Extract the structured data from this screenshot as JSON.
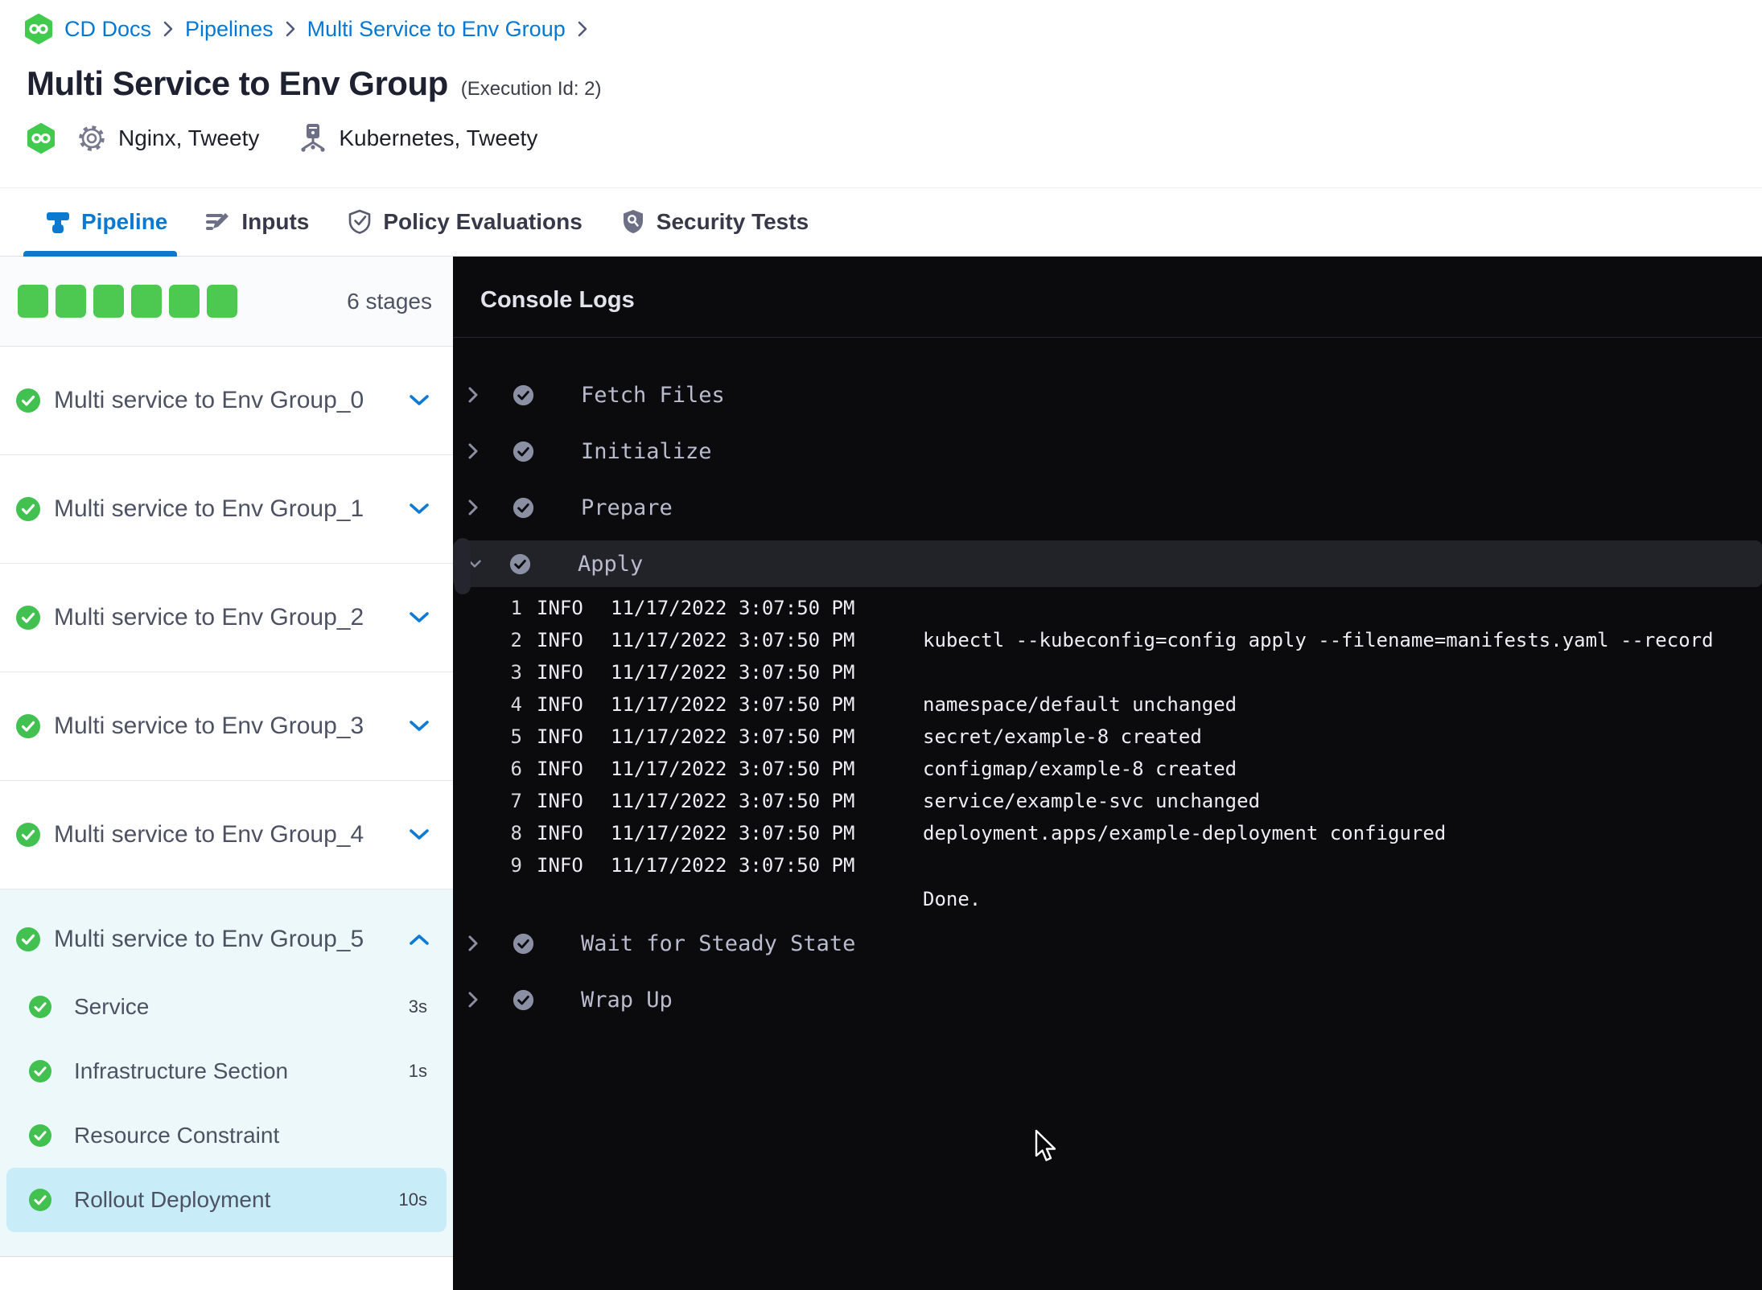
{
  "breadcrumb": {
    "links": [
      "CD Docs",
      "Pipelines",
      "Multi Service to Env Group"
    ]
  },
  "header": {
    "title": "Multi Service to Env Group",
    "execution_id": "(Execution Id: 2)",
    "service_names": "Nginx, Tweety",
    "infrastructure_names": "Kubernetes, Tweety"
  },
  "tabs": [
    {
      "label": "Pipeline",
      "active": true
    },
    {
      "label": "Inputs",
      "active": false
    },
    {
      "label": "Policy Evaluations",
      "active": false
    },
    {
      "label": "Security Tests",
      "active": false
    }
  ],
  "stages_panel": {
    "summary": {
      "count_label": "6 stages",
      "completed_squares": 6
    },
    "stages": [
      {
        "label": "Multi service to Env Group_0",
        "status": "success",
        "expanded": false
      },
      {
        "label": "Multi service to Env Group_1",
        "status": "success",
        "expanded": false
      },
      {
        "label": "Multi service to Env Group_2",
        "status": "success",
        "expanded": false
      },
      {
        "label": "Multi service to Env Group_3",
        "status": "success",
        "expanded": false
      },
      {
        "label": "Multi service to Env Group_4",
        "status": "success",
        "expanded": false
      },
      {
        "label": "Multi service to Env Group_5",
        "status": "success",
        "expanded": true,
        "steps": [
          {
            "label": "Service",
            "duration": "3s",
            "status": "success",
            "selected": false
          },
          {
            "label": "Infrastructure Section",
            "duration": "1s",
            "status": "success",
            "selected": false
          },
          {
            "label": "Resource Constraint",
            "duration": "",
            "status": "success",
            "selected": false
          },
          {
            "label": "Rollout Deployment",
            "duration": "10s",
            "status": "success",
            "selected": true
          }
        ]
      }
    ]
  },
  "console": {
    "title": "Console Logs",
    "sections": [
      {
        "label": "Fetch Files",
        "state": "collapsed"
      },
      {
        "label": "Initialize",
        "state": "collapsed"
      },
      {
        "label": "Prepare",
        "state": "collapsed"
      },
      {
        "label": "Apply",
        "state": "expanded",
        "logs": [
          {
            "n": "1",
            "level": "INFO",
            "time": "11/17/2022 3:07:50 PM",
            "msg": ""
          },
          {
            "n": "2",
            "level": "INFO",
            "time": "11/17/2022 3:07:50 PM",
            "msg": "kubectl --kubeconfig=config apply --filename=manifests.yaml --record"
          },
          {
            "n": "3",
            "level": "INFO",
            "time": "11/17/2022 3:07:50 PM",
            "msg": ""
          },
          {
            "n": "4",
            "level": "INFO",
            "time": "11/17/2022 3:07:50 PM",
            "msg": "namespace/default unchanged"
          },
          {
            "n": "5",
            "level": "INFO",
            "time": "11/17/2022 3:07:50 PM",
            "msg": "secret/example-8 created"
          },
          {
            "n": "6",
            "level": "INFO",
            "time": "11/17/2022 3:07:50 PM",
            "msg": "configmap/example-8 created"
          },
          {
            "n": "7",
            "level": "INFO",
            "time": "11/17/2022 3:07:50 PM",
            "msg": "service/example-svc unchanged"
          },
          {
            "n": "8",
            "level": "INFO",
            "time": "11/17/2022 3:07:50 PM",
            "msg": "deployment.apps/example-deployment configured"
          },
          {
            "n": "9",
            "level": "INFO",
            "time": "11/17/2022 3:07:50 PM",
            "msg": ""
          }
        ],
        "footer": "Done."
      },
      {
        "label": "Wait for Steady State",
        "state": "collapsed"
      },
      {
        "label": "Wrap Up",
        "state": "collapsed"
      }
    ]
  },
  "colors": {
    "accent_blue": "#0b79d0",
    "link_blue": "#0278d5",
    "success_green": "#4dc952",
    "selected_step_bg": "#c9edf8",
    "expanded_stage_bg": "#edf8fb",
    "console_bg": "#0b0b0d",
    "console_row_highlight": "#212329"
  }
}
